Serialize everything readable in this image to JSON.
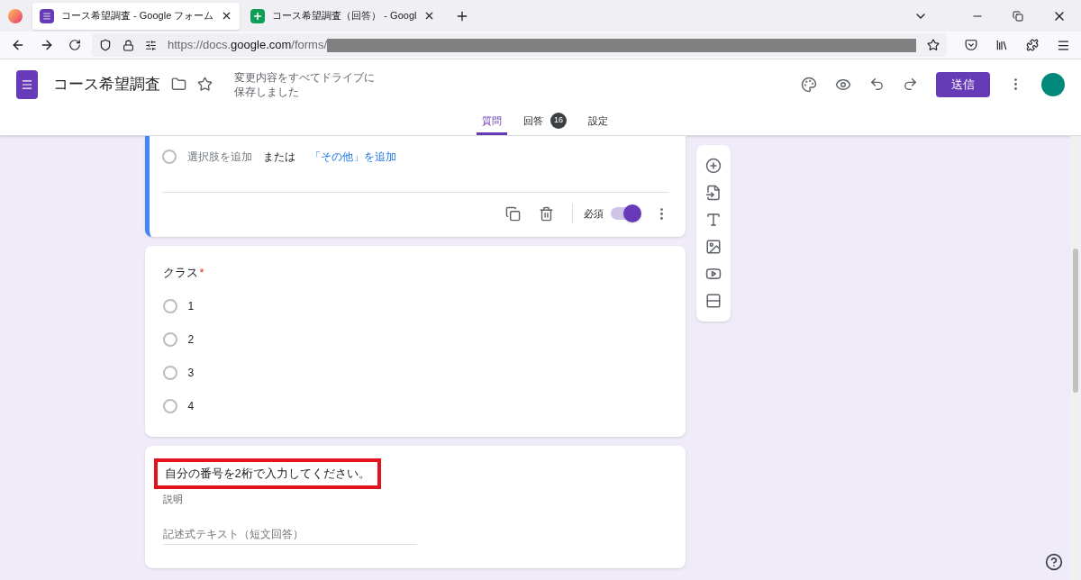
{
  "browser": {
    "tabs": [
      {
        "title": "コース希望調査 - Google フォーム",
        "kind": "forms",
        "selected": true
      },
      {
        "title": "コース希望調査（回答） - Googl",
        "kind": "sheets",
        "selected": false
      }
    ],
    "url_host_prefix": "https://docs.",
    "url_host": "google.com",
    "url_path": "/forms/"
  },
  "header": {
    "title": "コース希望調査",
    "save_status": [
      "変更内容をすべてドライブに",
      "保存しました"
    ],
    "send_button": "送信",
    "nav_tabs": [
      {
        "label": "質問",
        "selected": true
      },
      {
        "label": "回答",
        "badge": "16",
        "selected": false
      },
      {
        "label": "設定",
        "selected": false
      }
    ]
  },
  "question_footer": {
    "add_option_selected": false,
    "add_option": "選択肢を追加",
    "or": "または",
    "add_other": "「その他」を追加",
    "required_label": "必須",
    "required": true
  },
  "class_question": {
    "title": "クラス",
    "required": true,
    "required_mark": "*",
    "options": [
      {
        "label": "1",
        "selected": false
      },
      {
        "label": "2",
        "selected": false
      },
      {
        "label": "3",
        "selected": false
      },
      {
        "label": "4",
        "selected": false
      }
    ]
  },
  "number_question": {
    "title": "自分の番号を2桁で入力してください。",
    "highlighted": true,
    "description_placeholder": "説明",
    "answer_placeholder": "記述式テキスト（短文回答）"
  }
}
